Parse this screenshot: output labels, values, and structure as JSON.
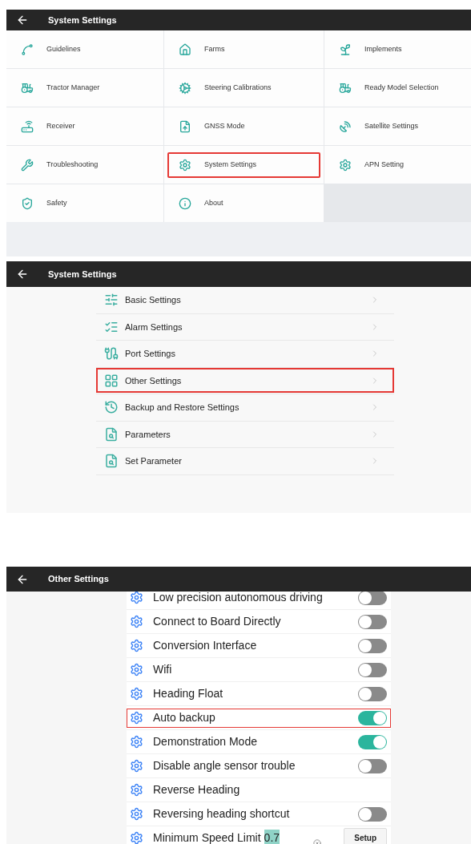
{
  "main_menu": {
    "title": "System Settings",
    "items": [
      {
        "label": "Guidelines",
        "highlighted": false
      },
      {
        "label": "Farms",
        "highlighted": false
      },
      {
        "label": "Implements",
        "highlighted": false
      },
      {
        "label": "Tractor Manager",
        "highlighted": false
      },
      {
        "label": "Steering Calibrations",
        "highlighted": false
      },
      {
        "label": "Ready Model Selection",
        "highlighted": false
      },
      {
        "label": "Receiver",
        "highlighted": false
      },
      {
        "label": "GNSS Mode",
        "highlighted": false
      },
      {
        "label": "Satellite Settings",
        "highlighted": false
      },
      {
        "label": "Troubleshooting",
        "highlighted": false
      },
      {
        "label": "System Settings",
        "highlighted": true
      },
      {
        "label": "APN Setting",
        "highlighted": false
      },
      {
        "label": "Safety",
        "highlighted": false
      },
      {
        "label": "About",
        "highlighted": false
      }
    ]
  },
  "system_settings": {
    "title": "System Settings",
    "items": [
      {
        "label": "Basic Settings",
        "highlighted": false
      },
      {
        "label": "Alarm Settings",
        "highlighted": false
      },
      {
        "label": "Port Settings",
        "highlighted": false
      },
      {
        "label": "Other Settings",
        "highlighted": true
      },
      {
        "label": "Backup and Restore Settings",
        "highlighted": false
      },
      {
        "label": "Parameters",
        "highlighted": false
      },
      {
        "label": "Set Parameter",
        "highlighted": false
      }
    ]
  },
  "other_settings": {
    "title": "Other Settings",
    "items": [
      {
        "kind": "toggle",
        "label": "Low precision autonomous driving",
        "on": false,
        "highlighted": false
      },
      {
        "kind": "toggle",
        "label": "Connect to Board Directly",
        "on": false,
        "highlighted": false
      },
      {
        "kind": "toggle",
        "label": "Conversion Interface",
        "on": false,
        "highlighted": false
      },
      {
        "kind": "toggle",
        "label": "Wifi",
        "on": false,
        "highlighted": false
      },
      {
        "kind": "toggle",
        "label": "Heading Float",
        "on": false,
        "highlighted": false
      },
      {
        "kind": "toggle",
        "label": "Auto backup",
        "on": true,
        "highlighted": true
      },
      {
        "kind": "toggle",
        "label": "Demonstration Mode",
        "on": true,
        "highlighted": false
      },
      {
        "kind": "toggle",
        "label": "Disable angle sensor trouble",
        "on": false,
        "highlighted": false
      },
      {
        "kind": "plain",
        "label": "Reverse Heading",
        "highlighted": false
      },
      {
        "kind": "toggle",
        "label": "Reversing heading shortcut",
        "on": false,
        "highlighted": false
      },
      {
        "kind": "input",
        "label": "Minimum Speed Limit",
        "value": "0.7",
        "button": "Setup",
        "highlighted": false
      }
    ]
  }
}
